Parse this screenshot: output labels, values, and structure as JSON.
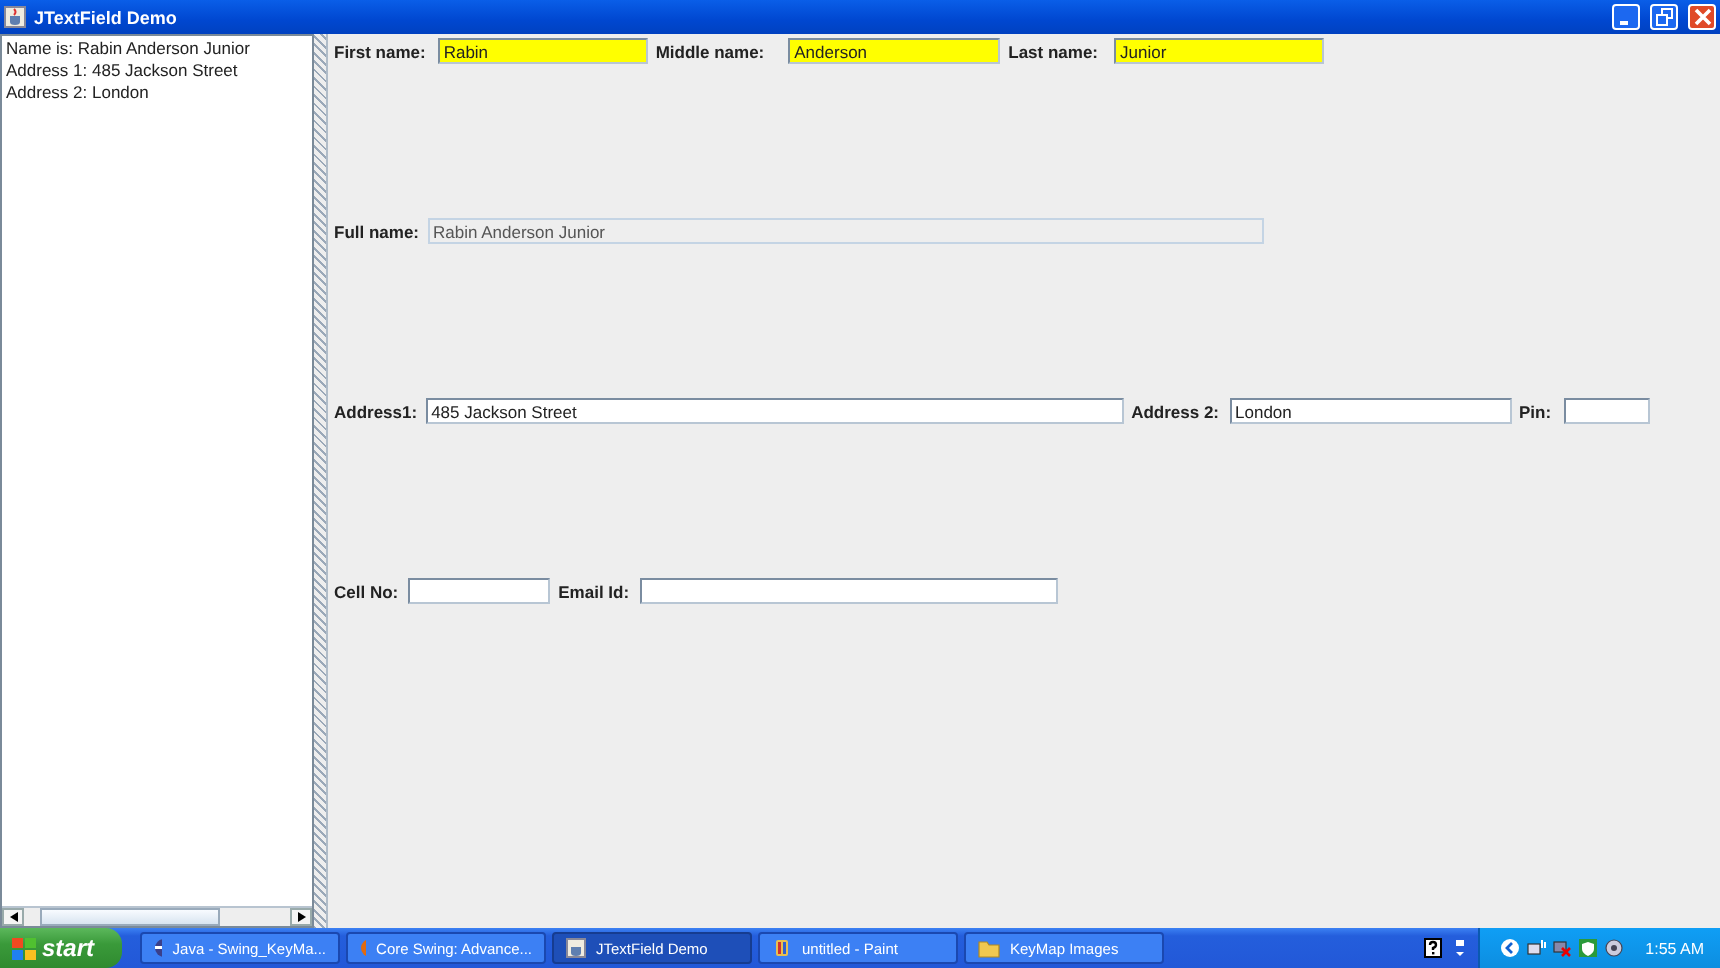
{
  "window": {
    "title": "JTextField Demo"
  },
  "output_area": {
    "lines": [
      "Name is: Rabin Anderson Junior",
      "Address 1: 485 Jackson Street",
      "Address 2: London"
    ]
  },
  "form": {
    "rows": [
      {
        "fields": [
          {
            "label": "First name:",
            "value": "Rabin",
            "highlighted": true,
            "editable": true
          },
          {
            "label": "Middle name:",
            "value": "Anderson",
            "highlighted": true,
            "editable": true
          },
          {
            "label": "Last name:",
            "value": "Junior",
            "highlighted": true,
            "editable": true
          }
        ]
      },
      {
        "fields": [
          {
            "label": "Full name:",
            "value": "Rabin Anderson Junior",
            "highlighted": false,
            "editable": false
          }
        ]
      },
      {
        "fields": [
          {
            "label": "Address1:",
            "value": "485 Jackson Street",
            "highlighted": false,
            "editable": true
          },
          {
            "label": "Address 2:",
            "value": "London",
            "highlighted": false,
            "editable": true
          },
          {
            "label": "Pin:",
            "highlighted": false,
            "editable": true
          }
        ]
      },
      {
        "fields": [
          {
            "label": "Cell No:",
            "highlighted": false,
            "editable": true
          },
          {
            "label": "Email Id:",
            "highlighted": false,
            "editable": true
          }
        ]
      }
    ]
  },
  "taskbar": {
    "start": "start",
    "tasks": [
      {
        "label": "Java - Swing_KeyMa...",
        "selected": false
      },
      {
        "label": "Core Swing: Advance...",
        "selected": false
      },
      {
        "label": "JTextField Demo",
        "selected": true
      },
      {
        "label": "untitled - Paint",
        "selected": false
      },
      {
        "label": "KeyMap Images",
        "selected": false
      }
    ],
    "clock": "1:55 AM"
  }
}
